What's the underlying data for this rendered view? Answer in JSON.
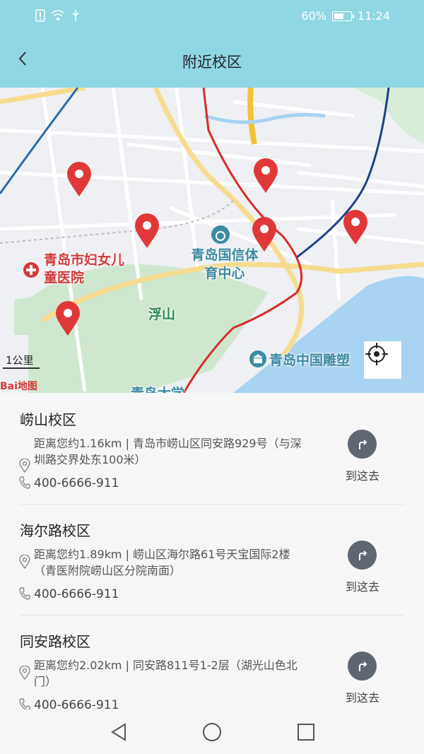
{
  "status_bar": {
    "battery": "60%",
    "time": "11:24",
    "battery_level": 0.6
  },
  "header": {
    "title": "附近校区",
    "back_icon": "chevron-left-icon"
  },
  "map": {
    "labels": {
      "hospital": "青岛市妇女儿童医院",
      "stadium": "青岛国信体育中心",
      "fushan": "浮山",
      "sculpture": "青岛中国雕塑",
      "university": "青岛大学"
    },
    "scale": "1公里",
    "logo": "Bai地图",
    "pin_color": "#e03838"
  },
  "campuses": [
    {
      "name": "崂山校区",
      "address": "距离您约1.16km | 青岛市崂山区同安路929号（与深圳路交界处东100米）",
      "phone": "400-6666-911",
      "go_label": "到这去"
    },
    {
      "name": "海尔路校区",
      "address": "距离您约1.89km | 崂山区海尔路61号天宝国际2楼（青医附院崂山区分院南面）",
      "phone": "400-6666-911",
      "go_label": "到这去"
    },
    {
      "name": "同安路校区",
      "address": "距离您约2.02km | 同安路811号1-2层（湖光山色北门）",
      "phone": "400-6666-911",
      "go_label": "到这去"
    }
  ],
  "colors": {
    "header_bg": "#8fd7e2",
    "go_button": "#5f6672"
  }
}
